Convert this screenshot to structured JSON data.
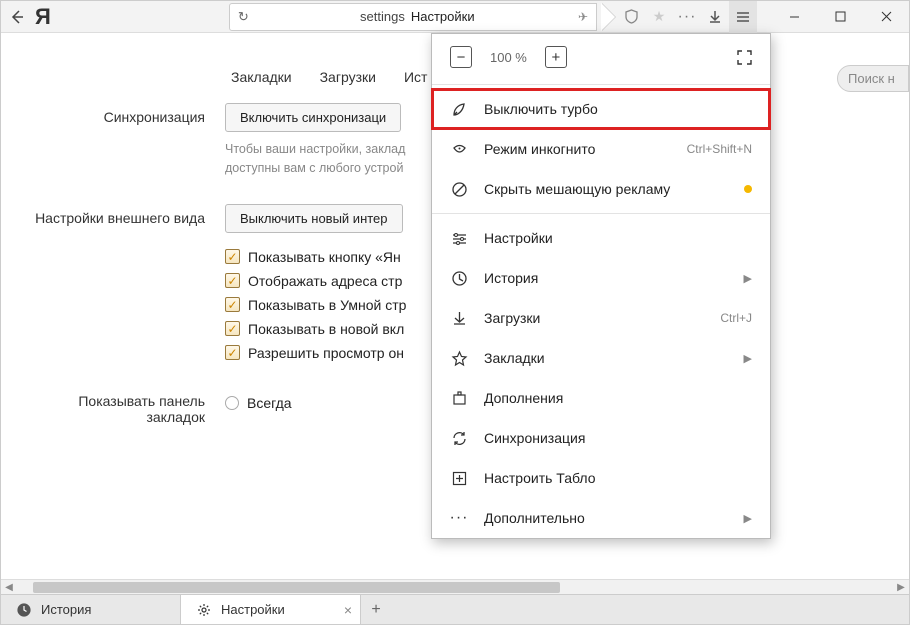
{
  "toolbar": {
    "address_host": "settings",
    "address_title": "Настройки"
  },
  "navtabs": [
    "Закладки",
    "Загрузки",
    "Ист"
  ],
  "search_placeholder": "Поиск н",
  "sections": {
    "sync": {
      "label": "Синхронизация",
      "button": "Включить синхронизаци",
      "hint1": "Чтобы ваши настройки, заклад",
      "hint2": "доступны вам с любого устрой"
    },
    "appearance": {
      "label": "Настройки внешнего вида",
      "button": "Выключить новый интер",
      "chk1": "Показывать кнопку «Ян",
      "chk2": "Отображать адреса стр",
      "chk3": "Показывать в Умной стр",
      "chk4": "Показывать в новой вкл",
      "chk5": "Разрешить просмотр он"
    },
    "bookmarksbar": {
      "label": "Показывать панель закладок",
      "opt1": "Всегда"
    }
  },
  "menu": {
    "zoom": "100 %",
    "turbo": "Выключить турбо",
    "incognito": {
      "label": "Режим инкогнито",
      "shortcut": "Ctrl+Shift+N"
    },
    "adblock": "Скрыть мешающую рекламу",
    "settings": "Настройки",
    "history": "История",
    "downloads": {
      "label": "Загрузки",
      "shortcut": "Ctrl+J"
    },
    "bookmarks": "Закладки",
    "addons": "Дополнения",
    "syncmenu": "Синхронизация",
    "tableau": "Настроить Табло",
    "more": "Дополнительно"
  },
  "bottomtabs": {
    "history": "История",
    "settings": "Настройки"
  }
}
